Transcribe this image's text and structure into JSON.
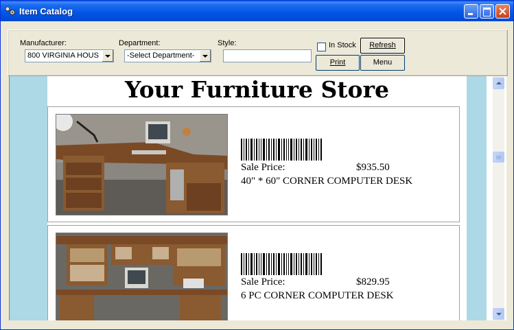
{
  "window": {
    "title": "Item Catalog"
  },
  "filters": {
    "manufacturer_label": "Manufacturer:",
    "manufacturer_value": "800  VIRGINIA HOUS",
    "department_label": "Department:",
    "department_value": "-Select Department-",
    "style_label": "Style:",
    "style_value": "",
    "in_stock_label": "In Stock",
    "in_stock_checked": false
  },
  "buttons": {
    "refresh": "Refresh",
    "print": "Print",
    "menu": "Menu"
  },
  "catalog": {
    "store_name": "Your Furniture Store",
    "items": [
      {
        "price_label": "Sale Price:",
        "price": "$935.50",
        "description": "40\" * 60\" CORNER COMPUTER DESK"
      },
      {
        "price_label": "Sale Price:",
        "price": "$829.95",
        "description": "6 PC CORNER COMPUTER DESK"
      }
    ]
  },
  "colors": {
    "title_bar": "#0054e3",
    "catalog_background": "#add8e6",
    "window_face": "#ece9d8"
  }
}
